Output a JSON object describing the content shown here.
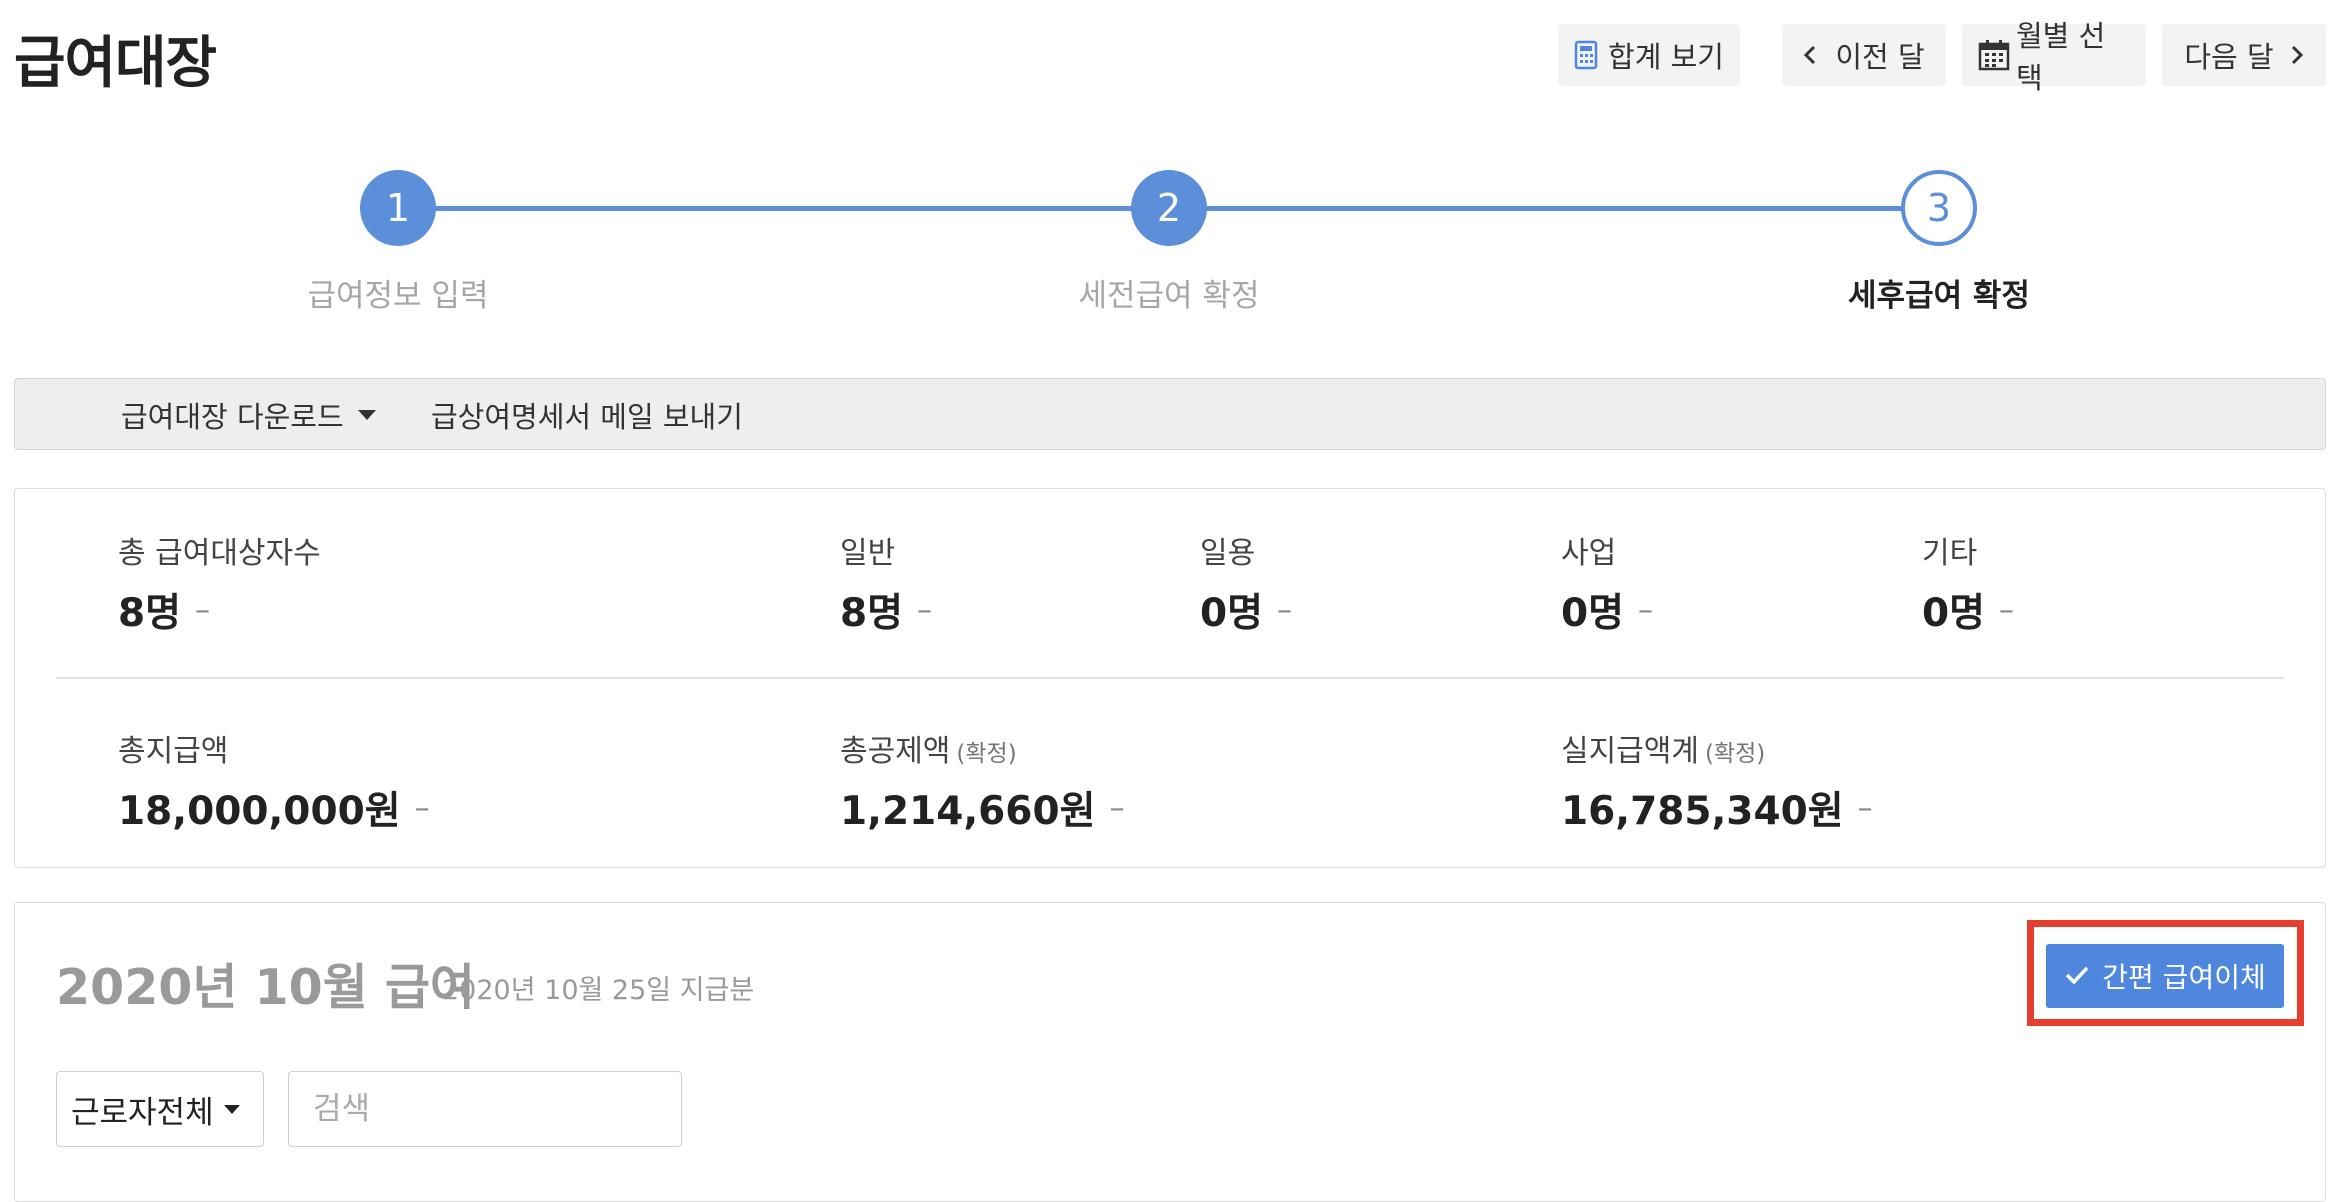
{
  "header": {
    "title": "급여대장",
    "total_view_label": "합계 보기",
    "prev_month_label": "이전 달",
    "month_select_label": "월별 선택",
    "next_month_label": "다음 달"
  },
  "stepper": {
    "steps": [
      {
        "number": "1",
        "label": "급여정보 입력",
        "status": "done"
      },
      {
        "number": "2",
        "label": "세전급여 확정",
        "status": "done"
      },
      {
        "number": "3",
        "label": "세후급여 확정",
        "status": "current"
      }
    ]
  },
  "actions": {
    "download_label": "급여대장 다운로드",
    "email_label": "급상여명세서 메일 보내기"
  },
  "summary": {
    "total_targets": {
      "label": "총 급여대상자수",
      "value": "8명"
    },
    "general": {
      "label": "일반",
      "value": "8명"
    },
    "daily": {
      "label": "일용",
      "value": "0명"
    },
    "business": {
      "label": "사업",
      "value": "0명"
    },
    "other": {
      "label": "기타",
      "value": "0명"
    },
    "total_pay": {
      "label": "총지급액",
      "value": "18,000,000원"
    },
    "total_deduction": {
      "label": "총공제액",
      "note": "(확정)",
      "value": "1,214,660원"
    },
    "net_pay": {
      "label": "실지급액계",
      "note": "(확정)",
      "value": "16,785,340원"
    },
    "dash": "–"
  },
  "payroll": {
    "title": "2020년 10월 급여",
    "subtitle": "2020년 10월 25일 지급분",
    "transfer_button": "간편 급여이체",
    "filter_selected": "근로자전체",
    "search_placeholder": "검색"
  },
  "colors": {
    "accent": "#5b8fd9",
    "button_blue": "#4f87df",
    "highlight": "#e5402f"
  }
}
